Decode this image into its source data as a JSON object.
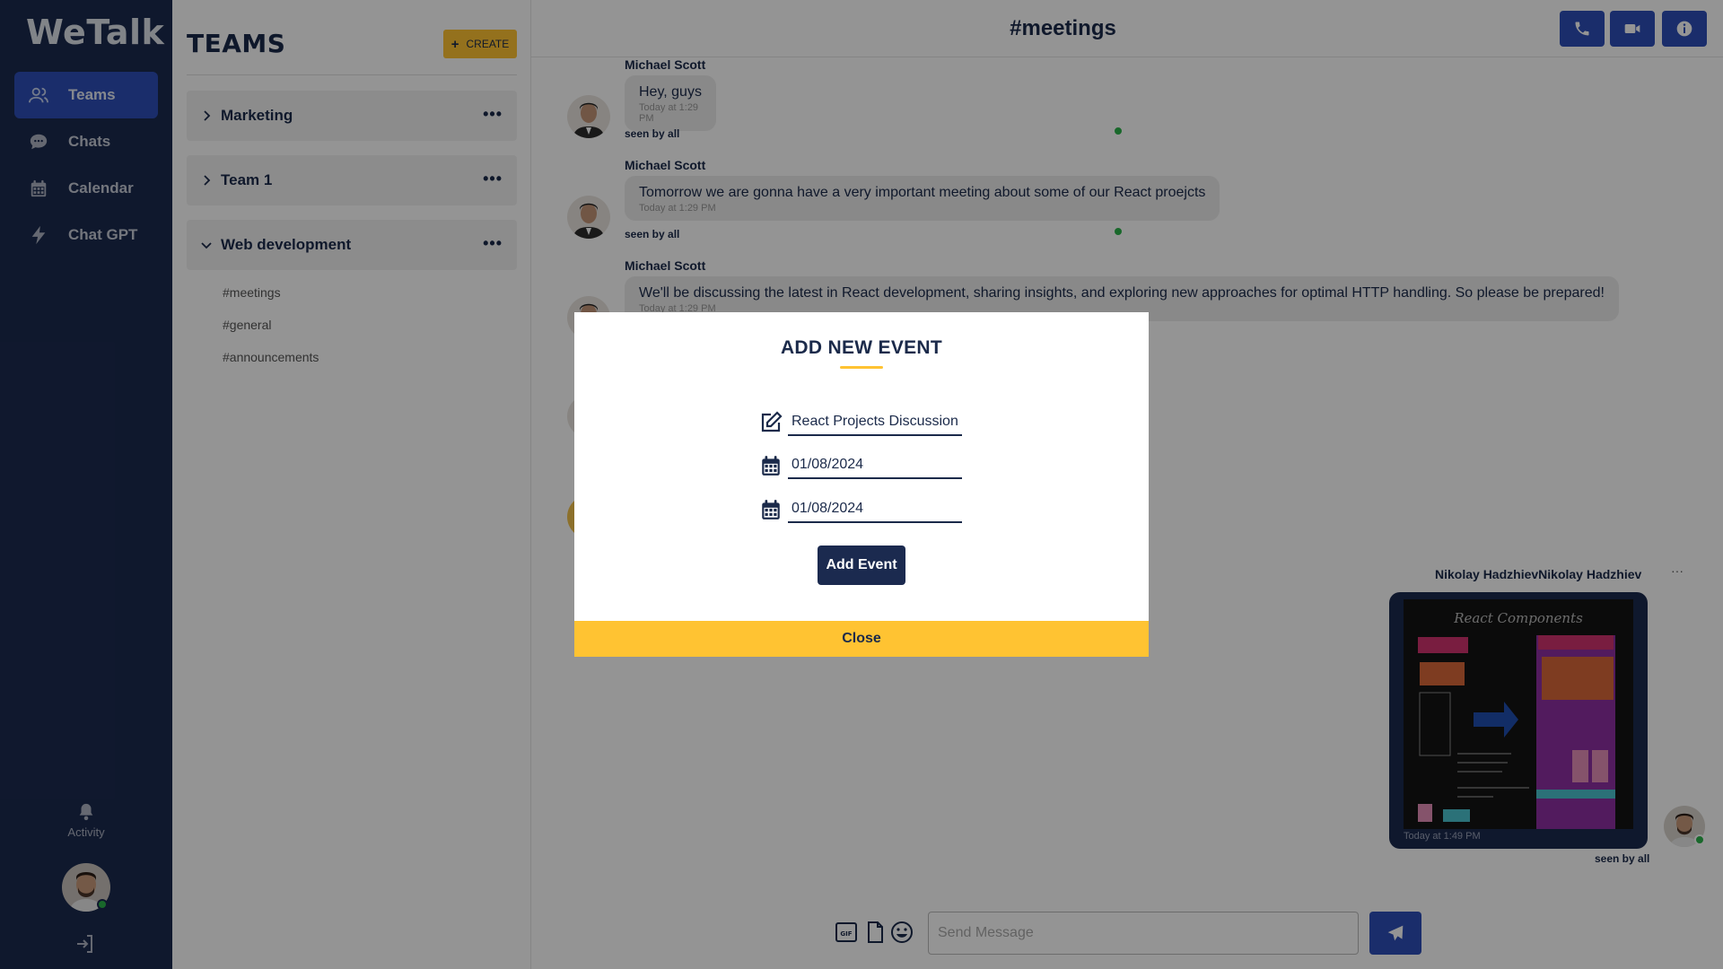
{
  "app": {
    "logo": "WeTalk"
  },
  "nav": {
    "items": [
      {
        "label": "Teams",
        "icon": "users-icon",
        "active": true
      },
      {
        "label": "Chats",
        "icon": "chat-bubble-icon",
        "active": false
      },
      {
        "label": "Calendar",
        "icon": "calendar-icon",
        "active": false
      },
      {
        "label": "Chat GPT",
        "icon": "bolt-icon",
        "active": false
      }
    ],
    "activity_label": "Activity"
  },
  "teams": {
    "title": "TEAMS",
    "create_label": "CREATE",
    "list": [
      {
        "name": "Marketing",
        "expanded": false
      },
      {
        "name": "Team 1",
        "expanded": false
      },
      {
        "name": "Web development",
        "expanded": true
      }
    ],
    "channels": [
      "#meetings",
      "#general",
      "#announcements"
    ]
  },
  "chat": {
    "title": "#meetings",
    "messages": [
      {
        "sender": "Michael Scott",
        "text": "Hey, guys",
        "time": "Today at 1:29 PM",
        "seen": "seen by all"
      },
      {
        "sender": "Michael Scott",
        "text": "Tomorrow we are gonna have a very important meeting about some of our React proejcts",
        "time": "Today at 1:29 PM",
        "seen": "seen by all"
      },
      {
        "sender": "Michael Scott",
        "text": "We'll be discussing the latest in React development, sharing insights, and exploring new approaches for optimal HTTP handling. So please be prepared!",
        "time": "Today at 1:29 PM",
        "seen": ""
      }
    ],
    "my_message": {
      "sender": "Nikolay HadzhievNikolay Hadzhiev",
      "menu": "···",
      "image_title": "React Components",
      "time": "Today at 1:49 PM",
      "seen": "seen by all"
    },
    "composer": {
      "placeholder": "Send Message"
    }
  },
  "modal": {
    "title": "ADD NEW EVENT",
    "event_name": "React Projects Discussion",
    "start_date": "01/08/2024",
    "end_date": "01/08/2024",
    "add_label": "Add Event",
    "close_label": "Close"
  },
  "colors": {
    "nav_bg": "#1b2a4f",
    "accent_blue": "#2d4fb8",
    "accent_yellow": "#ffc332",
    "online": "#2bb44a"
  }
}
